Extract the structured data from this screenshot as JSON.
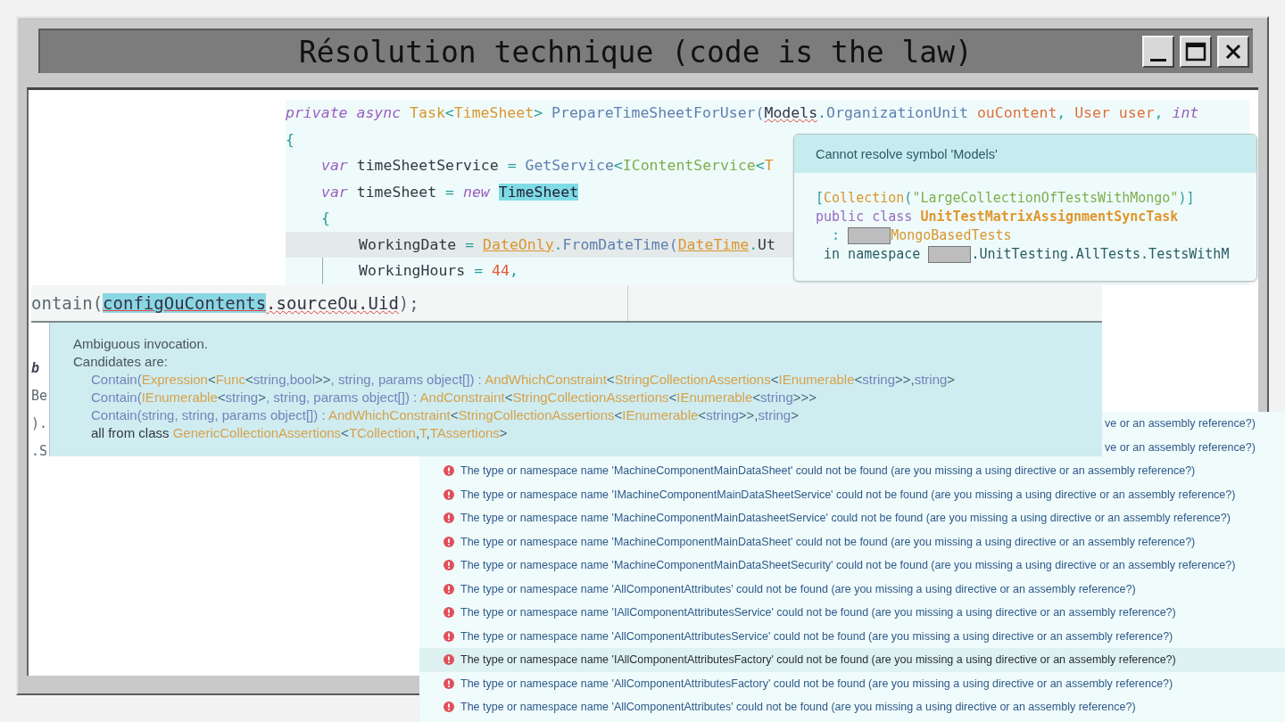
{
  "window": {
    "title": "Résolution technique (code is the law)"
  },
  "editor": {
    "lines": [
      {
        "current": false,
        "tokens": [
          {
            "text": "private async ",
            "kind": "kw"
          },
          {
            "text": "Task",
            "kind": "type"
          },
          {
            "text": "<",
            "kind": "punct"
          },
          {
            "text": "TimeSheet",
            "kind": "type"
          },
          {
            "text": "> ",
            "kind": "punct"
          },
          {
            "text": "PrepareTimeSheetForUser(",
            "kind": "method"
          },
          {
            "text": "Models",
            "kind": "err"
          },
          {
            "text": ".",
            "kind": "punct"
          },
          {
            "text": "OrganizationUnit ",
            "kind": "method"
          },
          {
            "text": "ouContent",
            "kind": "param"
          },
          {
            "text": ", ",
            "kind": "punct"
          },
          {
            "text": "User user",
            "kind": "param"
          },
          {
            "text": ", ",
            "kind": "punct"
          },
          {
            "text": "int",
            "kind": "kw"
          }
        ]
      },
      {
        "current": false,
        "tokens": [
          {
            "text": "{",
            "kind": "punct"
          }
        ],
        "children": [
          {
            "current": false,
            "tokens": [
              {
                "text": "var",
                "kind": "kw"
              },
              {
                "text": " timeSheetService ",
                "kind": "plain"
              },
              {
                "text": "= ",
                "kind": "punct"
              },
              {
                "text": "GetService",
                "kind": "method"
              },
              {
                "text": "<",
                "kind": "punct"
              },
              {
                "text": "IContentService",
                "kind": "green"
              },
              {
                "text": "<",
                "kind": "punct"
              },
              {
                "text": "T",
                "kind": "type"
              }
            ]
          },
          {
            "current": false,
            "tokens": [
              {
                "text": "var",
                "kind": "kw"
              },
              {
                "text": " timeSheet ",
                "kind": "plain"
              },
              {
                "text": "= ",
                "kind": "punct"
              },
              {
                "text": "new ",
                "kind": "kw"
              },
              {
                "text": "TimeSheet",
                "kind": "hl"
              }
            ]
          },
          {
            "current": false,
            "tokens": [
              {
                "text": "{",
                "kind": "punct"
              }
            ],
            "children": [
              {
                "current": true,
                "tokens": [
                  {
                    "text": "WorkingDate ",
                    "kind": "plain"
                  },
                  {
                    "text": "= ",
                    "kind": "punct"
                  },
                  {
                    "text": "DateOnly",
                    "kind": "link"
                  },
                  {
                    "text": ".",
                    "kind": "punct"
                  },
                  {
                    "text": "FromDateTime(",
                    "kind": "method"
                  },
                  {
                    "text": "DateTime",
                    "kind": "link"
                  },
                  {
                    "text": ".",
                    "kind": "punct"
                  },
                  {
                    "text": "Ut",
                    "kind": "plain"
                  }
                ]
              },
              {
                "current": false,
                "tokens": [
                  {
                    "text": "WorkingHours ",
                    "kind": "plain"
                  },
                  {
                    "text": "= ",
                    "kind": "punct"
                  },
                  {
                    "text": "44",
                    "kind": "num"
                  },
                  {
                    "text": ",",
                    "kind": "punct"
                  }
                ]
              }
            ]
          }
        ]
      }
    ]
  },
  "symbol_tooltip": {
    "message": "Cannot resolve symbol 'Models'",
    "lines": [
      [
        {
          "text": "[",
          "kind": "punct"
        },
        {
          "text": "Collection",
          "kind": "type"
        },
        {
          "text": "(",
          "kind": "punct"
        },
        {
          "text": "\"LargeCollectionOfTestsWithMongo\"",
          "kind": "green"
        },
        {
          "text": ")]",
          "kind": "punct"
        }
      ],
      [
        {
          "text": "public class ",
          "kind": "kw2"
        },
        {
          "text": "UnitTestMatrixAssignmentSyncTask",
          "kind": "bold"
        }
      ],
      [
        {
          "text": "  : ",
          "kind": "punct"
        },
        {
          "kind": "redacted"
        },
        {
          "text": "MongoBasedTests",
          "kind": "type"
        }
      ],
      [
        {
          "text": " in namespace ",
          "kind": "dark"
        },
        {
          "kind": "redacted"
        },
        {
          "text": ".UnitTesting.AllTests.TestsWithM",
          "kind": "dark"
        }
      ]
    ]
  },
  "invocation": {
    "code": [
      {
        "text": "ontain(",
        "kind": "grey"
      },
      {
        "text": "configOuContents",
        "kind": "hlerr"
      },
      {
        "text": ".sourceOu.Uid",
        "kind": "err"
      },
      {
        "text": ");",
        "kind": "grey"
      }
    ],
    "side_fragments": [
      {
        "text": "b",
        "kind": "italic"
      },
      {
        "text": "Be",
        "kind": "grey"
      },
      {
        "text": ").",
        "kind": "grey"
      },
      {
        "text": ".S",
        "kind": "grey"
      }
    ],
    "title": "Ambiguous invocation.",
    "subtitle": "Candidates are:",
    "candidates": [
      [
        {
          "text": "Contain(",
          "kind": "m"
        },
        {
          "text": "Expression",
          "kind": "t"
        },
        {
          "text": "<",
          "kind": "p"
        },
        {
          "text": "Func",
          "kind": "t"
        },
        {
          "text": "<",
          "kind": "p"
        },
        {
          "text": "string,bool",
          "kind": "m"
        },
        {
          "text": ">>",
          "kind": "p"
        },
        {
          "text": ", string, params object[]) : ",
          "kind": "m"
        },
        {
          "text": "AndWhichConstraint",
          "kind": "t"
        },
        {
          "text": "<",
          "kind": "p"
        },
        {
          "text": "StringCollectionAssertions",
          "kind": "t"
        },
        {
          "text": "<",
          "kind": "p"
        },
        {
          "text": "IEnumerable",
          "kind": "t"
        },
        {
          "text": "<",
          "kind": "p"
        },
        {
          "text": "string",
          "kind": "m"
        },
        {
          "text": ">>,",
          "kind": "p"
        },
        {
          "text": "string",
          "kind": "m"
        },
        {
          "text": ">",
          "kind": "p"
        }
      ],
      [
        {
          "text": "Contain(",
          "kind": "m"
        },
        {
          "text": "IEnumerable",
          "kind": "t"
        },
        {
          "text": "<",
          "kind": "p"
        },
        {
          "text": "string",
          "kind": "m"
        },
        {
          "text": ">",
          "kind": "p"
        },
        {
          "text": ", string, params object[]) : ",
          "kind": "m"
        },
        {
          "text": "AndConstraint",
          "kind": "t"
        },
        {
          "text": "<",
          "kind": "p"
        },
        {
          "text": "StringCollectionAssertions",
          "kind": "t"
        },
        {
          "text": "<",
          "kind": "p"
        },
        {
          "text": "IEnumerable",
          "kind": "t"
        },
        {
          "text": "<",
          "kind": "p"
        },
        {
          "text": "string",
          "kind": "m"
        },
        {
          "text": ">>>",
          "kind": "p"
        }
      ],
      [
        {
          "text": "Contain(string, string, params object[]) : ",
          "kind": "m"
        },
        {
          "text": "AndWhichConstraint",
          "kind": "t"
        },
        {
          "text": "<",
          "kind": "p"
        },
        {
          "text": "StringCollectionAssertions",
          "kind": "t"
        },
        {
          "text": "<",
          "kind": "p"
        },
        {
          "text": "IEnumerable",
          "kind": "t"
        },
        {
          "text": "<",
          "kind": "p"
        },
        {
          "text": "string",
          "kind": "m"
        },
        {
          "text": ">>,",
          "kind": "p"
        },
        {
          "text": "string",
          "kind": "m"
        },
        {
          "text": ">",
          "kind": "p"
        }
      ]
    ],
    "footer": [
      {
        "text": "all from class ",
        "kind": "plain"
      },
      {
        "text": "GenericCollectionAssertions",
        "kind": "t"
      },
      {
        "text": "<",
        "kind": "p"
      },
      {
        "text": "TCollection",
        "kind": "t"
      },
      {
        "text": ",",
        "kind": "p"
      },
      {
        "text": "T",
        "kind": "t"
      },
      {
        "text": ",",
        "kind": "p"
      },
      {
        "text": "TAssertions",
        "kind": "t"
      },
      {
        "text": ">",
        "kind": "p"
      }
    ]
  },
  "errors": [
    {
      "kind": "partial",
      "selected": false,
      "text": "ve or an assembly reference?)"
    },
    {
      "kind": "partial",
      "selected": false,
      "text": "ve or an assembly reference?)"
    },
    {
      "kind": "full",
      "selected": false,
      "text": "The type or namespace name 'MachineComponentMainDataSheet' could not be found (are you missing a using directive or an assembly reference?)"
    },
    {
      "kind": "full",
      "selected": false,
      "text": "The type or namespace name 'IMachineComponentMainDataSheetService' could not be found (are you missing a using directive or an assembly reference?)"
    },
    {
      "kind": "full",
      "selected": false,
      "text": "The type or namespace name 'MachineComponentMainDatasheetService' could not be found (are you missing a using directive or an assembly reference?)"
    },
    {
      "kind": "full",
      "selected": false,
      "text": "The type or namespace name 'MachineComponentMainDataSheet' could not be found (are you missing a using directive or an assembly reference?)"
    },
    {
      "kind": "full",
      "selected": false,
      "text": "The type or namespace name 'MachineComponentMainDataSheetSecurity' could not be found (are you missing a using directive or an assembly reference?)"
    },
    {
      "kind": "full",
      "selected": false,
      "text": "The type or namespace name 'AllComponentAttributes' could not be found (are you missing a using directive or an assembly reference?)"
    },
    {
      "kind": "full",
      "selected": false,
      "text": "The type or namespace name 'IAllComponentAttributesService' could not be found (are you missing a using directive or an assembly reference?)"
    },
    {
      "kind": "full",
      "selected": false,
      "text": "The type or namespace name 'AllComponentAttributesService' could not be found (are you missing a using directive or an assembly reference?)"
    },
    {
      "kind": "full",
      "selected": true,
      "text": "The type or namespace name 'IAllComponentAttributesFactory' could not be found (are you missing a using directive or an assembly reference?)"
    },
    {
      "kind": "full",
      "selected": false,
      "text": "The type or namespace name 'AllComponentAttributesFactory' could not be found (are you missing a using directive or an assembly reference?)"
    },
    {
      "kind": "full",
      "selected": false,
      "text": "The type or namespace name 'AllComponentAttributes' could not be found (are you missing a using directive or an assembly reference?)"
    }
  ]
}
